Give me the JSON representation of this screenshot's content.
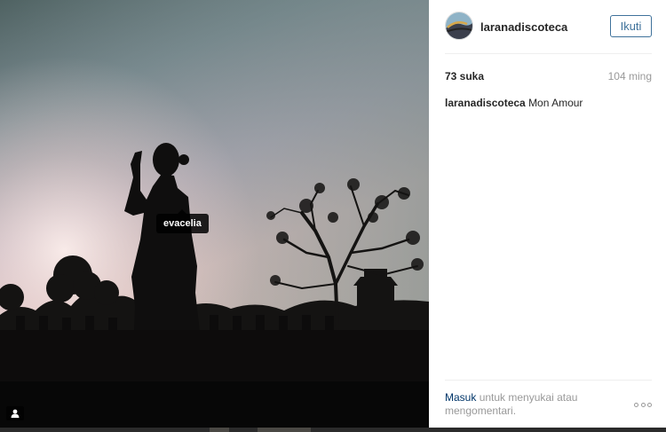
{
  "photo": {
    "tag_label": "evacelia"
  },
  "post": {
    "author": "laranadiscoteca",
    "follow_label": "Ikuti",
    "likes": "73 suka",
    "age": "104 ming",
    "caption_user": "laranadiscoteca",
    "caption_text": "Mon Amour"
  },
  "footer": {
    "login_link": "Masuk",
    "login_rest": "untuk menyukai atau mengomentari."
  },
  "colors": {
    "link": "#003569",
    "button": "#3f729b"
  },
  "icons": [
    "user-tag-icon",
    "more-options-icon"
  ]
}
